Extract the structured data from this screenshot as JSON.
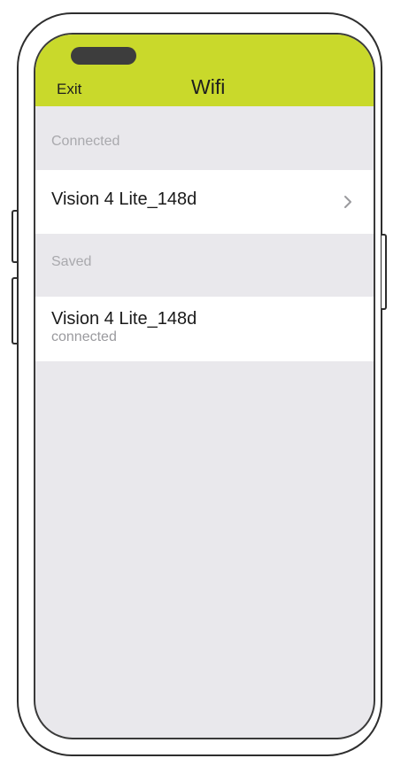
{
  "header": {
    "exit_label": "Exit",
    "title": "Wifi"
  },
  "connected_section": {
    "label": "Connected",
    "network_name": "Vision 4 Lite_148d",
    "chevron_icon": "chevron-right-icon"
  },
  "saved_section": {
    "label": "Saved",
    "network_name": "Vision 4 Lite_148d",
    "status": "connected"
  },
  "colors": {
    "header_accent": "#c9d92b",
    "screen_background": "#e9e8ec",
    "row_background": "#ffffff"
  }
}
